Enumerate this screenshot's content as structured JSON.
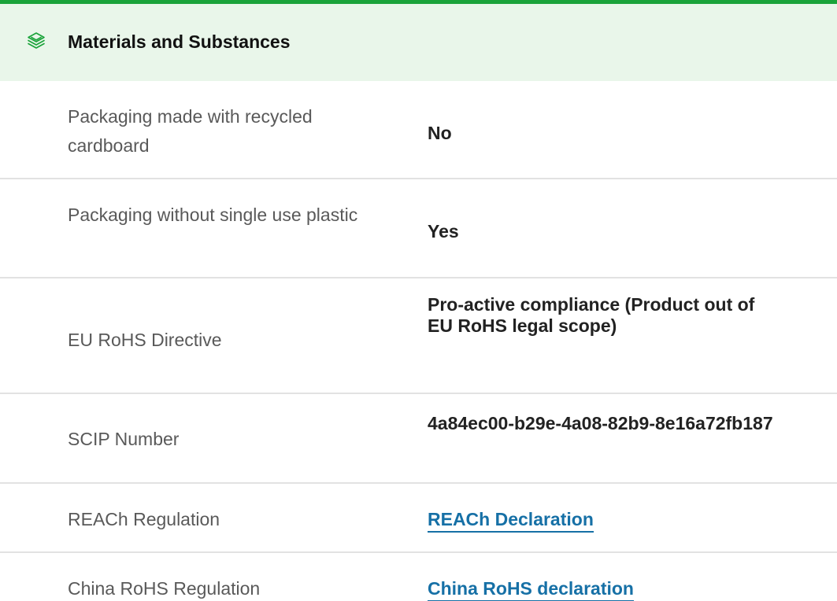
{
  "section": {
    "title": "Materials and Substances",
    "icon": "layers-icon",
    "accent_color": "#1aa33a",
    "header_background": "#e9f6ea"
  },
  "rows": [
    {
      "label": "Packaging made with recycled cardboard",
      "value": "No"
    },
    {
      "label": "Packaging without single use plastic",
      "value": "Yes"
    },
    {
      "label": "EU RoHS Directive",
      "value": "Pro-active compliance (Product out of EU RoHS legal scope)"
    },
    {
      "label": "SCIP Number",
      "value": "4a84ec00-b29e-4a08-82b9-8e16a72fb187"
    },
    {
      "label": "REACh Regulation",
      "value": "REACh Declaration",
      "is_link": true
    },
    {
      "label": "China RoHS Regulation",
      "value": "China RoHS declaration",
      "is_link": true
    }
  ],
  "link_color": "#1670a6"
}
